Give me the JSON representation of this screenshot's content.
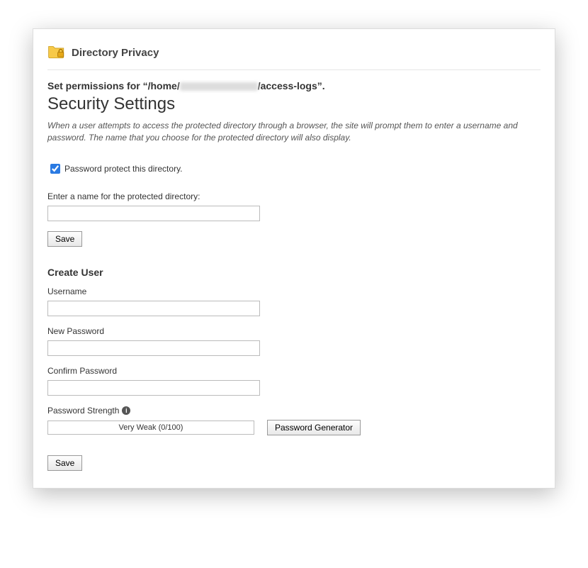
{
  "header": {
    "title": "Directory Privacy"
  },
  "permissions": {
    "prefix": "Set permissions for “/home/",
    "suffix": "/access-logs”."
  },
  "security": {
    "heading": "Security Settings",
    "description": "When a user attempts to access the protected directory through a browser, the site will prompt them to enter a username and password. The name that you choose for the protected directory will also display.",
    "checkbox_label": "Password protect this directory.",
    "checkbox_checked": true,
    "dirname_label": "Enter a name for the protected directory:",
    "dirname_value": "",
    "save_label": "Save"
  },
  "create_user": {
    "heading": "Create User",
    "username_label": "Username",
    "username_value": "",
    "newpw_label": "New Password",
    "newpw_value": "",
    "confirmpw_label": "Confirm Password",
    "confirmpw_value": "",
    "strength_label": "Password Strength",
    "strength_text": "Very Weak (0/100)",
    "generator_label": "Password Generator",
    "save_label": "Save"
  }
}
